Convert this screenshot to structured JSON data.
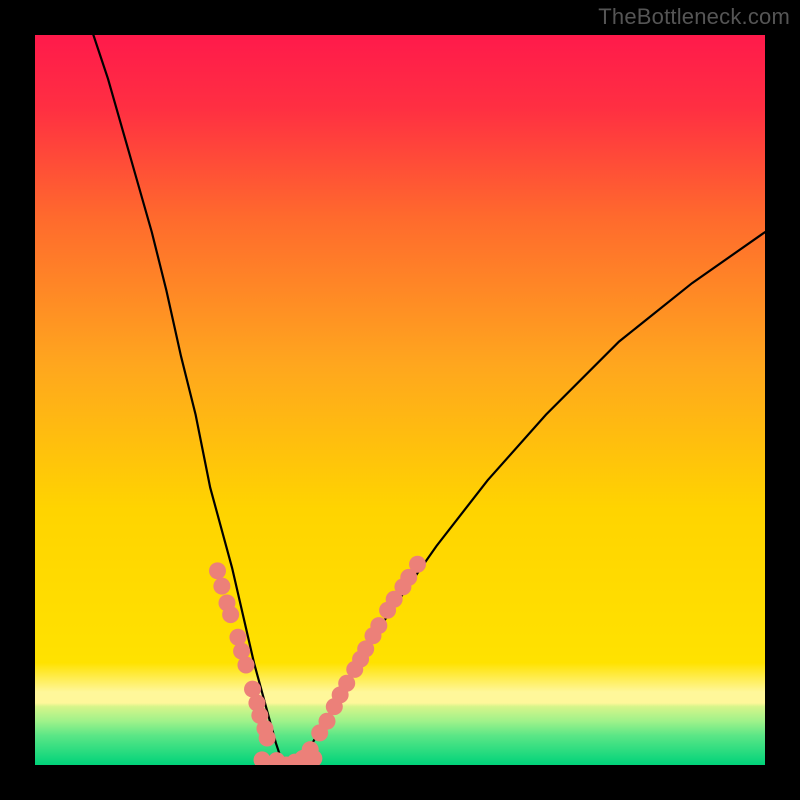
{
  "watermark": "TheBottleneck.com",
  "chart_data": {
    "type": "line",
    "title": "",
    "xlabel": "",
    "ylabel": "",
    "xlim": [
      0,
      1
    ],
    "ylim": [
      0,
      1
    ],
    "grid": false,
    "legend": false,
    "background": {
      "top_color": "#ff1a4b",
      "mid_color": "#ffd400",
      "bottom_colors": [
        "#fff79a",
        "#9ff28a",
        "#00d37a"
      ],
      "description": "Vertical red-to-yellow gradient with thin pale-yellow, light-green, and green bands at the very bottom."
    },
    "series": [
      {
        "name": "bottleneck-curve",
        "description": "Smooth V-shaped black curve. Left arm starts at full height near x≈0.08, falls sharply to a minimum near x≈0.34 at y≈0.0, then rises more gently to about y≈0.73 at x=1.",
        "x": [
          0.08,
          0.1,
          0.12,
          0.14,
          0.16,
          0.18,
          0.2,
          0.22,
          0.24,
          0.27,
          0.3,
          0.33,
          0.34,
          0.36,
          0.38,
          0.42,
          0.48,
          0.55,
          0.62,
          0.7,
          0.8,
          0.9,
          1.0
        ],
        "y": [
          1.0,
          0.94,
          0.87,
          0.8,
          0.73,
          0.65,
          0.56,
          0.48,
          0.38,
          0.27,
          0.14,
          0.03,
          0.0,
          0.0,
          0.03,
          0.1,
          0.2,
          0.3,
          0.39,
          0.48,
          0.58,
          0.66,
          0.73
        ]
      }
    ],
    "markers": [
      {
        "name": "salmon-dots",
        "color": "#ec8079",
        "description": "Clusters of salmon-pink round markers along both arms of the curve near the trough.",
        "points": [
          {
            "x": 0.25,
            "y": 0.266
          },
          {
            "x": 0.256,
            "y": 0.245
          },
          {
            "x": 0.263,
            "y": 0.222
          },
          {
            "x": 0.268,
            "y": 0.206
          },
          {
            "x": 0.278,
            "y": 0.175
          },
          {
            "x": 0.283,
            "y": 0.156
          },
          {
            "x": 0.289,
            "y": 0.137
          },
          {
            "x": 0.298,
            "y": 0.104
          },
          {
            "x": 0.304,
            "y": 0.085
          },
          {
            "x": 0.308,
            "y": 0.068
          },
          {
            "x": 0.315,
            "y": 0.05
          },
          {
            "x": 0.318,
            "y": 0.037
          },
          {
            "x": 0.311,
            "y": 0.007
          },
          {
            "x": 0.331,
            "y": 0.006
          },
          {
            "x": 0.344,
            "y": 0.0
          },
          {
            "x": 0.356,
            "y": 0.004
          },
          {
            "x": 0.367,
            "y": 0.009
          },
          {
            "x": 0.377,
            "y": 0.021
          },
          {
            "x": 0.39,
            "y": 0.044
          },
          {
            "x": 0.4,
            "y": 0.06
          },
          {
            "x": 0.382,
            "y": 0.009
          },
          {
            "x": 0.41,
            "y": 0.08
          },
          {
            "x": 0.418,
            "y": 0.096
          },
          {
            "x": 0.427,
            "y": 0.112
          },
          {
            "x": 0.438,
            "y": 0.131
          },
          {
            "x": 0.446,
            "y": 0.145
          },
          {
            "x": 0.453,
            "y": 0.159
          },
          {
            "x": 0.463,
            "y": 0.177
          },
          {
            "x": 0.471,
            "y": 0.191
          },
          {
            "x": 0.483,
            "y": 0.212
          },
          {
            "x": 0.492,
            "y": 0.227
          },
          {
            "x": 0.504,
            "y": 0.244
          },
          {
            "x": 0.512,
            "y": 0.257
          },
          {
            "x": 0.524,
            "y": 0.275
          }
        ]
      }
    ]
  }
}
